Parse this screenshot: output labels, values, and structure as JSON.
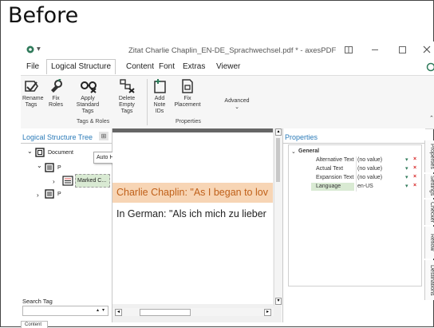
{
  "heading": "Before",
  "app_title": "Zitat Charlie Chaplin_EN-DE_Sprachwechsel.pdf * - axesPDF",
  "menu": {
    "items": [
      "File",
      "Logical Structure",
      "Content",
      "Font",
      "Extras",
      "Viewer"
    ],
    "active": "Logical Structure"
  },
  "ribbon": {
    "rename_tags": "Rename Tags",
    "fix_roles": "Fix Roles",
    "apply_standard_tags": "Apply Standard Tags",
    "delete_empty_tags": "Delete Empty Tags",
    "add_note_ids": "Add Note IDs",
    "fix_placement": "Fix Placement",
    "advanced": "Advanced",
    "group_tags_roles": "Tags & Roles",
    "group_properties": "Properties"
  },
  "tree": {
    "title": "Logical Structure Tree",
    "auto_hide": "Auto Hide",
    "document": "Document",
    "p1": "P",
    "marked": "Marked C...",
    "p2": "P",
    "search_label": "Search Tag",
    "bottom_tab": "Content"
  },
  "doc": {
    "line1": "Charlie Chaplin: \"As I began to lov",
    "line2": "In German: \"Als ich mich zu lieber"
  },
  "properties": {
    "title": "Properties",
    "group": "General",
    "rows": [
      {
        "label": "Alternative Text",
        "value": "(no value)"
      },
      {
        "label": "Actual Text",
        "value": "(no value)"
      },
      {
        "label": "Expansion Text",
        "value": "(no value)"
      },
      {
        "label": "Language",
        "value": "en-US"
      }
    ]
  },
  "side_tabs": [
    "Properties",
    "Settings",
    "Checker",
    "Reflow",
    "Destinations"
  ],
  "colors": {
    "accent": "#2b7bb9",
    "highlight": "#f7d5b5",
    "selection": "#d9ead3",
    "delete_red": "#d62020"
  }
}
